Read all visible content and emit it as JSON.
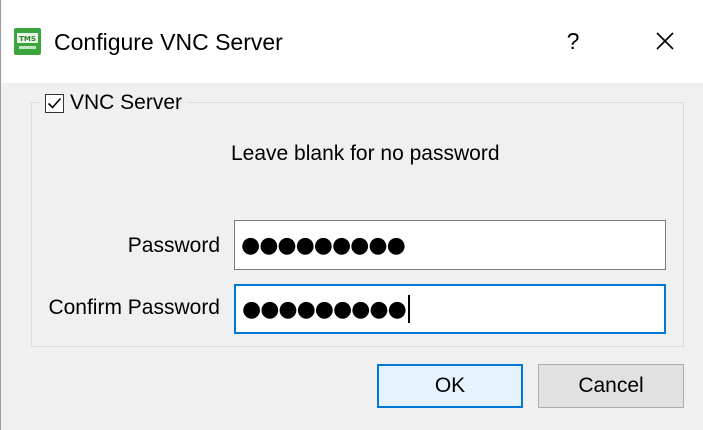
{
  "window": {
    "title": "Configure VNC Server",
    "help_label": "?",
    "icon_name": "vnc-app-icon",
    "icon_text": "TMS"
  },
  "group": {
    "label": "VNC Server",
    "checked": true
  },
  "hint": "Leave blank for no password",
  "fields": {
    "password_label": "Password",
    "password_value": "●●●●●●●●●",
    "confirm_label": "Confirm Password",
    "confirm_value": "●●●●●●●●●"
  },
  "buttons": {
    "ok": "OK",
    "cancel": "Cancel"
  },
  "colors": {
    "accent": "#0078d7",
    "icon_bg": "#3aa53a"
  }
}
